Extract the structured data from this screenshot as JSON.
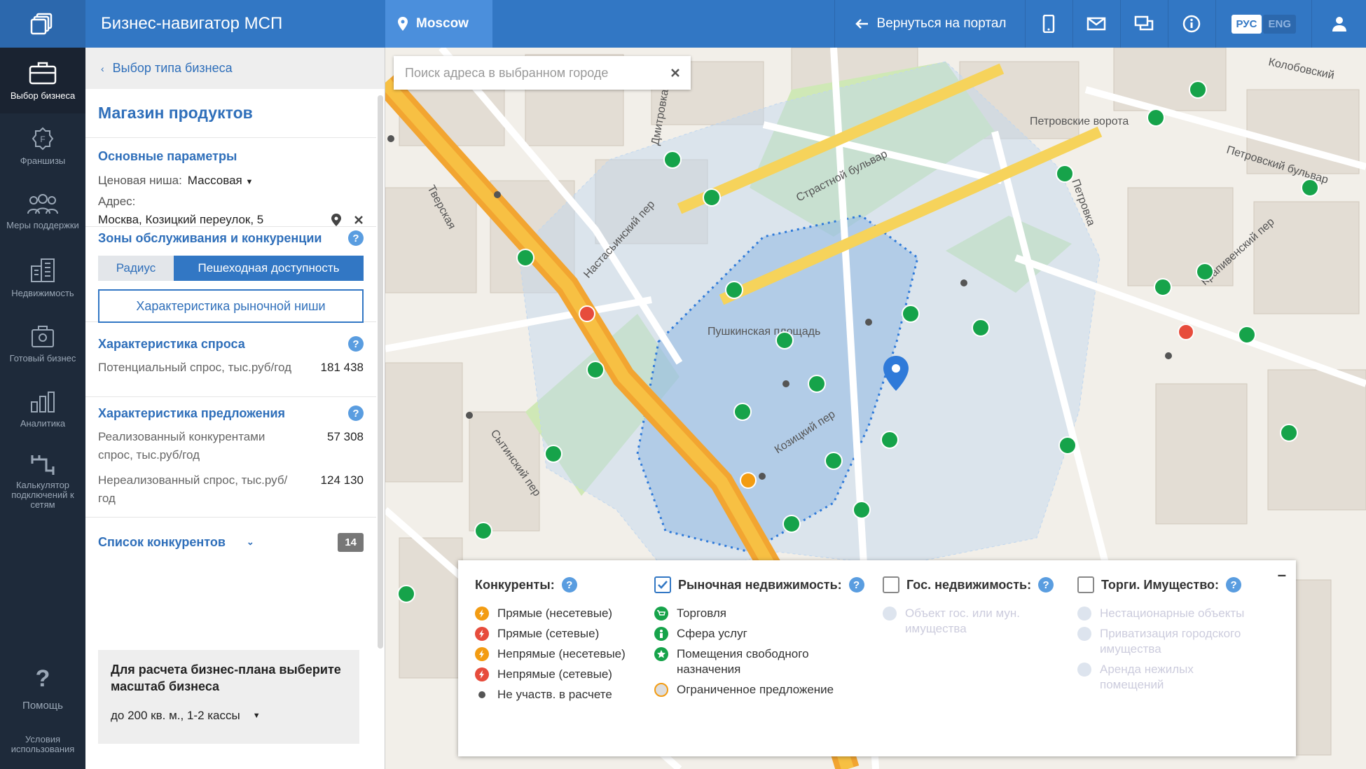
{
  "topbar": {
    "app_title": "Бизнес-навигатор МСП",
    "city": "Moscow",
    "back_to_portal": "Вернуться на портал",
    "lang_active": "РУС",
    "lang_inactive": "ENG"
  },
  "nav": {
    "items": [
      {
        "label": "Выбор бизнеса",
        "icon": "briefcase-icon",
        "active": true
      },
      {
        "label": "Франшизы",
        "icon": "franchise-icon"
      },
      {
        "label": "Меры поддержки",
        "icon": "people-icon"
      },
      {
        "label": "Недвижимость",
        "icon": "building-icon"
      },
      {
        "label": "Готовый бизнес",
        "icon": "bag-icon"
      },
      {
        "label": "Аналитика",
        "icon": "chart-icon"
      },
      {
        "label": "Калькулятор подключений к сетям",
        "icon": "pipe-icon"
      }
    ],
    "help": "Помощь",
    "terms": "Условия использования"
  },
  "panel": {
    "breadcrumb": "Выбор типа бизнеса",
    "business_title": "Магазин продуктов",
    "basic_params": {
      "title": "Основные параметры",
      "price_label": "Ценовая ниша:",
      "price_value": "Массовая",
      "address_label": "Адрес:",
      "address_value": "Москва, Козицкий переулок, 5"
    },
    "zones": {
      "title": "Зоны обслуживания и конкуренции",
      "radius": "Радиус",
      "walking": "Пешеходная доступность",
      "niche_button": "Характеристика рыночной ниши"
    },
    "demand": {
      "title": "Характеристика спроса",
      "label": "Потенциальный спрос, тыс.руб/год",
      "value": "181 438"
    },
    "supply": {
      "title": "Характеристика предложения",
      "realized_label": "Реализованный конкурентами спрос, тыс.руб/год",
      "realized_value": "57 308",
      "unrealized_label": "Нереализованный спрос, тыс.руб/год",
      "unrealized_value": "124 130"
    },
    "competitors": {
      "title": "Список конкурентов",
      "count": "14"
    },
    "plan": {
      "title": "Для расчета бизнес-плана выберите масштаб бизнеса",
      "selected": "до 200 кв. м., 1-2 кассы"
    }
  },
  "map": {
    "search_placeholder": "Поиск адреса в выбранном городе",
    "street_labels": [
      "Тверская",
      "Страстной бульвар",
      "Пушкинская площадь",
      "Козицкий пер",
      "Петровка",
      "Настасьинский пер",
      "Дмитровка",
      "Петровские ворота",
      "Петровский бульвар",
      "Сытинский пер",
      "Крапивенский пер",
      "Колобовский"
    ]
  },
  "legend": {
    "competitors": {
      "title": "Конкуренты:",
      "items": [
        {
          "label": "Прямые (несетевые)",
          "color": "#f39c12"
        },
        {
          "label": "Прямые (сетевые)",
          "color": "#e74c3c"
        },
        {
          "label": "Непрямые (несетевые)",
          "color": "#f39c12"
        },
        {
          "label": "Непрямые (сетевые)",
          "color": "#e74c3c"
        },
        {
          "label": "Не участв. в расчете",
          "color": "#555555"
        }
      ]
    },
    "market_realty": {
      "title": "Рыночная недвижимость:",
      "checked": true,
      "items": [
        {
          "label": "Торговля",
          "icon": "cart-icon"
        },
        {
          "label": "Сфера услуг",
          "icon": "person-icon"
        },
        {
          "label": "Помещения свободного назначения",
          "icon": "star-icon"
        },
        {
          "label": "Ограниченное предложение",
          "icon": "clock-icon"
        }
      ]
    },
    "gov_realty": {
      "title": "Гос. недвижимость:",
      "checked": false,
      "items": [
        {
          "label": "Объект гос. или мун. имущества"
        }
      ]
    },
    "auctions": {
      "title": "Торги. Имущество:",
      "checked": false,
      "items": [
        {
          "label": "Нестационарные объекты"
        },
        {
          "label": "Приватизация городского имущества"
        },
        {
          "label": "Аренда нежилых помещений"
        }
      ]
    }
  }
}
